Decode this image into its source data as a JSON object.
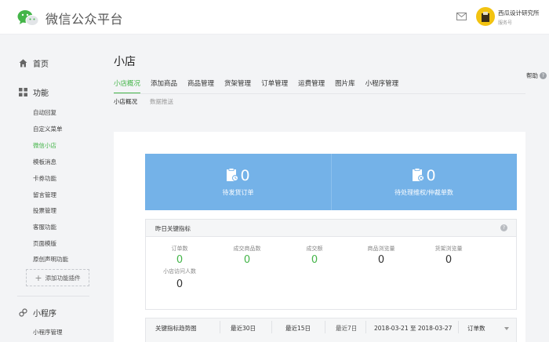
{
  "header": {
    "app_title": "微信公众平台",
    "account_name": "西瓜设计研究所",
    "account_type": "服务号",
    "icons": [
      "wechat-logo-icon",
      "mail-icon",
      "avatar"
    ]
  },
  "sidebar": {
    "home": "首页",
    "features_section": "功能",
    "feature_items": [
      "自动回复",
      "自定义菜单",
      "微信小店",
      "模板消息",
      "卡券功能",
      "留言管理",
      "投票管理",
      "客服功能",
      "页面模版",
      "原创声明功能"
    ],
    "active_item": "微信小店",
    "add_plugin": "添加功能插件",
    "miniprogram_section": "小程序",
    "miniprogram_items": [
      "小程序管理"
    ],
    "icons": [
      "home-icon",
      "grid-icon",
      "link-icon"
    ]
  },
  "page": {
    "title": "小店",
    "help": "帮助",
    "tabs": [
      "小店概况",
      "添加商品",
      "商品管理",
      "货架管理",
      "订单管理",
      "运费管理",
      "图片库",
      "小程序管理"
    ],
    "active_tab": "小店概况",
    "subtabs": [
      "小店概况",
      "数据推送"
    ]
  },
  "banner": {
    "pending_orders": {
      "value": "0",
      "label": "待发货订单"
    },
    "pending_rights": {
      "value": "0",
      "label": "待处理维权/仲裁单数"
    }
  },
  "metrics": {
    "title": "昨日关键指标",
    "items": [
      {
        "label": "订单数",
        "value": "0"
      },
      {
        "label": "成交商品数",
        "value": "0"
      },
      {
        "label": "成交额",
        "value": "0"
      },
      {
        "label": "商品浏览量",
        "value": "0"
      },
      {
        "label": "货架浏览量",
        "value": "0"
      },
      {
        "label": "小店访问人数",
        "value": "0"
      }
    ]
  },
  "trend": {
    "title": "关键指标趋势图",
    "ranges": [
      "最近30日",
      "最近15日",
      "最近7日"
    ],
    "selected_range": "最近7日",
    "date_range": "2018-03-21 至 2018-03-27",
    "metric_select": "订单数"
  },
  "colors": {
    "accent": "#44b549",
    "banner": "#74b2e8"
  }
}
